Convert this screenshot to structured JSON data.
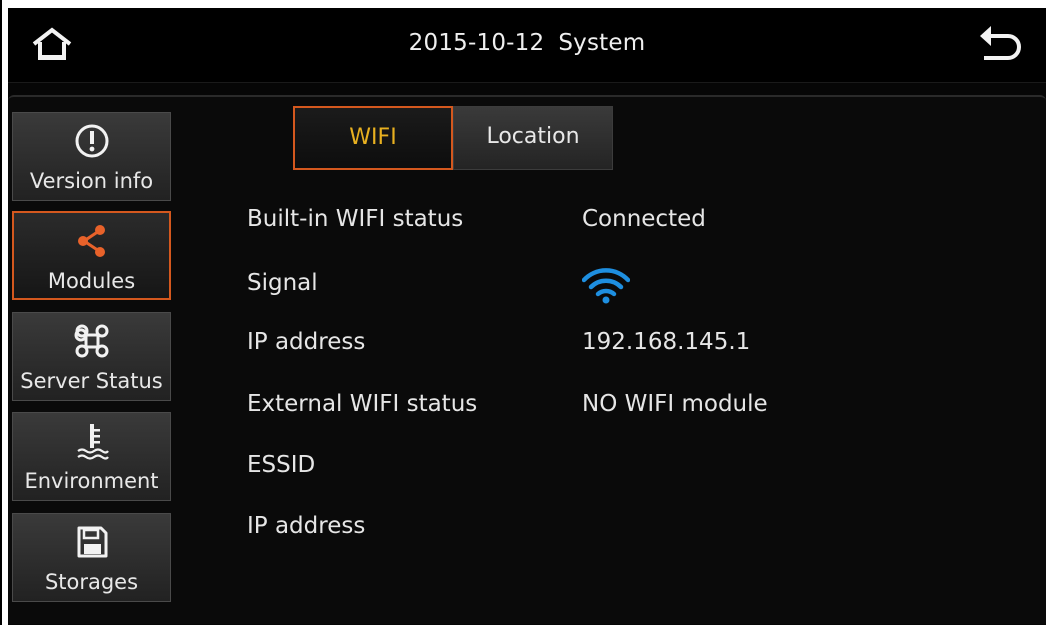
{
  "header": {
    "date": "2015-10-12",
    "title": "System"
  },
  "sidebar": {
    "items": [
      {
        "label": "Version info",
        "icon": "info-circle-icon",
        "active": false
      },
      {
        "label": "Modules",
        "icon": "share-nodes-icon",
        "active": true
      },
      {
        "label": "Server Status",
        "icon": "command-key-icon",
        "active": false
      },
      {
        "label": "Environment",
        "icon": "temperature-water-icon",
        "active": false
      },
      {
        "label": "Storages",
        "icon": "floppy-disk-icon",
        "active": false
      }
    ]
  },
  "tabs": [
    {
      "label": "WIFI",
      "active": true
    },
    {
      "label": "Location",
      "active": false
    }
  ],
  "wifi": {
    "rows": [
      {
        "label": "Built-in WIFI status",
        "value": "Connected"
      },
      {
        "label": "Signal",
        "value": ""
      },
      {
        "label": "IP address",
        "value": "192.168.145.1"
      },
      {
        "label": "External WIFI status",
        "value": "NO WIFI module"
      },
      {
        "label": "ESSID",
        "value": ""
      },
      {
        "label": "IP address",
        "value": ""
      }
    ],
    "signal_level": 1.0
  },
  "colors": {
    "accent": "#d4581e",
    "active_tab_text": "#e8b020",
    "wifi_signal": "#1e8fe0"
  }
}
